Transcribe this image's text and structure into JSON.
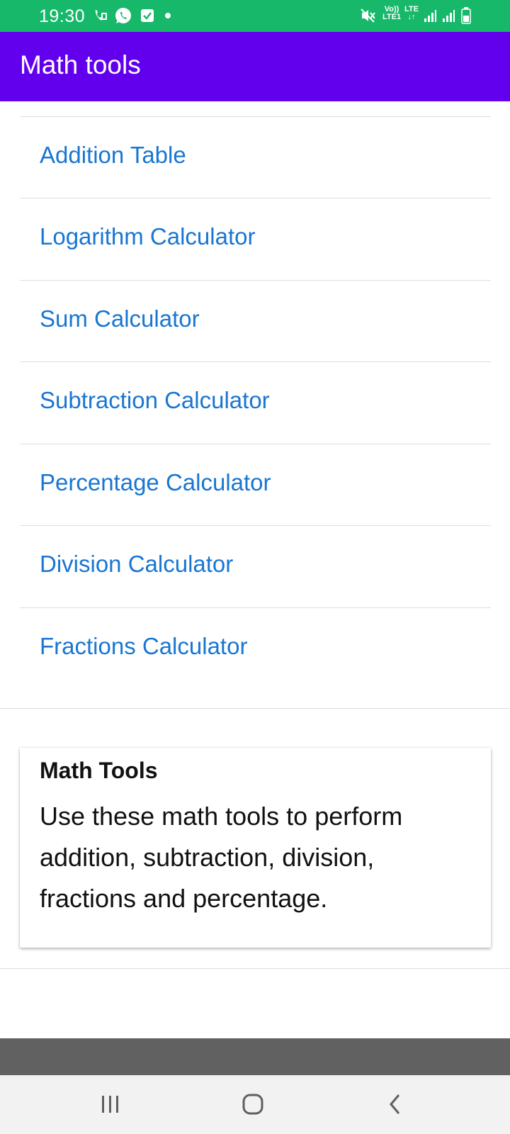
{
  "status_bar": {
    "time": "19:30",
    "volte_top": "Vo))",
    "volte_bottom": "LTE1",
    "lte_label": "LTE",
    "icons": [
      "call-forward-icon",
      "whatsapp-icon",
      "check-box-icon",
      "dot-icon",
      "mute-icon",
      "signal-icon",
      "signal-icon",
      "battery-icon"
    ],
    "color": "#17b86a"
  },
  "app_bar": {
    "title": "Math tools",
    "color": "#6200ee"
  },
  "list": {
    "link_color": "#1976d2",
    "items": [
      {
        "label": "Addition Table"
      },
      {
        "label": "Logarithm Calculator"
      },
      {
        "label": "Sum Calculator"
      },
      {
        "label": "Subtraction Calculator"
      },
      {
        "label": "Percentage Calculator"
      },
      {
        "label": "Division Calculator"
      },
      {
        "label": "Fractions Calculator"
      }
    ]
  },
  "info_card": {
    "title": "Math Tools",
    "body": "Use these math tools to perform addition, subtraction, division, fractions and percentage."
  },
  "nav_bar": {
    "buttons": [
      "recents-icon",
      "home-icon",
      "back-icon"
    ]
  }
}
